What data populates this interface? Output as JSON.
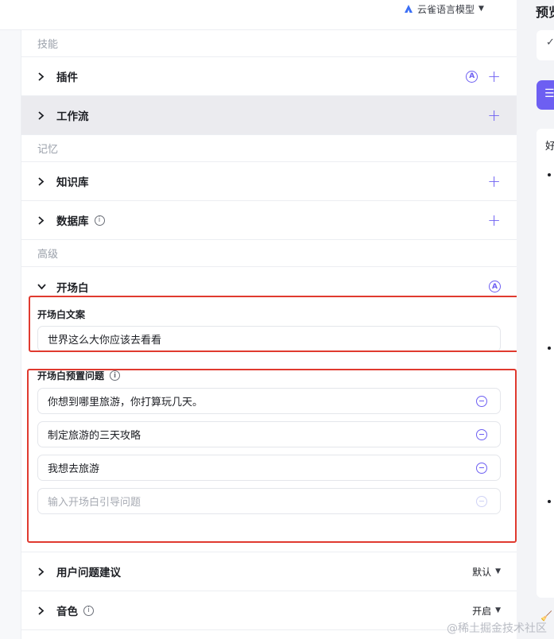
{
  "model": {
    "name": "云雀语言模型"
  },
  "sections": {
    "skills": "技能",
    "memory": "记忆",
    "advanced": "高级"
  },
  "rows": {
    "plugins": "插件",
    "workflow": "工作流",
    "knowledge": "知识库",
    "database": "数据库",
    "opening": "开场白",
    "suggestions": "用户问题建议",
    "voice": "音色"
  },
  "icons": {
    "auto": "A",
    "info": "i",
    "plus": "+"
  },
  "opening": {
    "text_label": "开场白文案",
    "text_value": "世界这么大你应该去看看",
    "questions_label": "开场白预置问题",
    "questions": [
      "你想到哪里旅游，你打算玩几天。",
      "制定旅游的三天攻略",
      "我想去旅游"
    ],
    "question_placeholder": "输入开场白引导问题"
  },
  "dropdowns": {
    "suggestions": "默认",
    "voice": "开启"
  },
  "preview": {
    "title": "预览",
    "char": "好"
  },
  "watermark": "@稀土掘金技术社区",
  "colors": {
    "accent": "#6d5ff2",
    "annotation": "#e03a2f"
  }
}
